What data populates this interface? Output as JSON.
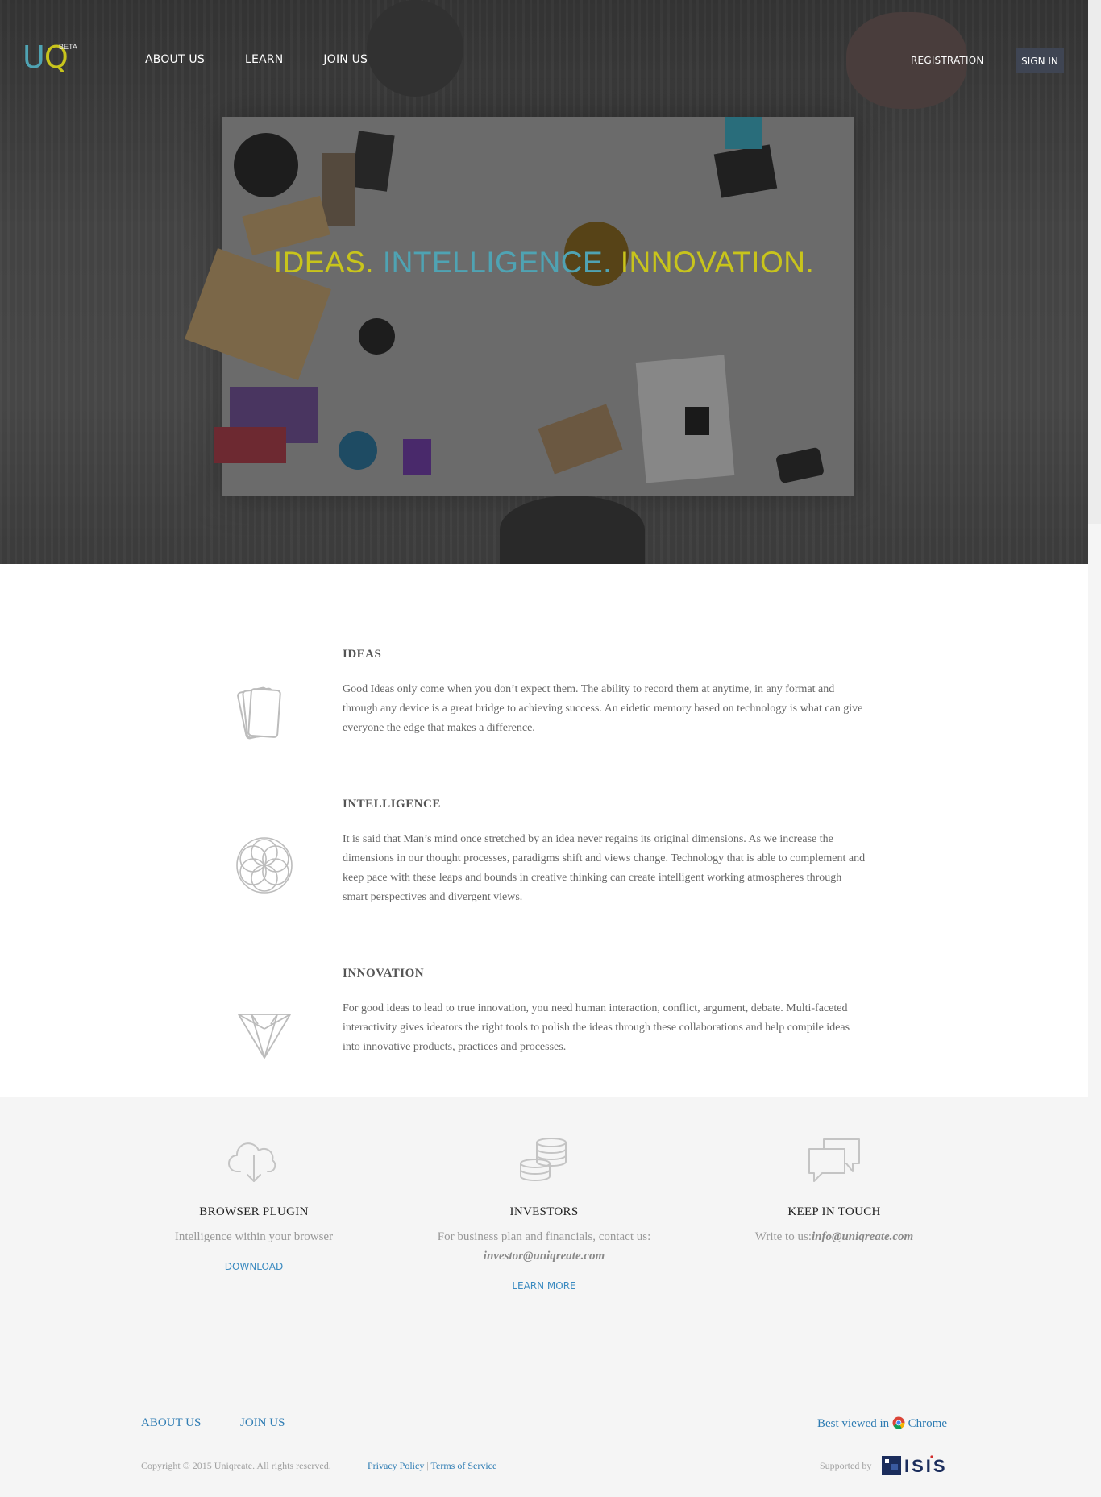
{
  "header": {
    "logo_u": "U",
    "logo_q": "Q",
    "beta": "BETA",
    "nav": [
      "ABOUT US",
      "LEARN",
      "JOIN US"
    ],
    "registration": "REGISTRATION",
    "sign_in": "SIGN IN"
  },
  "hero": {
    "tagline_1": "IDEAS.",
    "tagline_2": "INTELLIGENCE.",
    "tagline_3": "INNOVATION."
  },
  "features": [
    {
      "title": "IDEAS",
      "icon": "cards-icon",
      "text": "Good Ideas only come when you don’t expect them. The ability to record them at anytime, in any format and through any device is a great bridge to achieving success. An eidetic memory based on technology is what can give everyone the edge that makes a difference."
    },
    {
      "title": "INTELLIGENCE",
      "icon": "flower-of-life-icon",
      "text": "It is said that Man’s mind once stretched by an idea never regains its original dimensions. As we increase the dimensions in our thought processes, paradigms shift and views change. Technology that is able to complement and keep pace with these leaps and bounds in creative thinking can create intelligent working atmospheres through smart perspectives and divergent views."
    },
    {
      "title": "INNOVATION",
      "icon": "diamond-icon",
      "text": "For good ideas to lead to true innovation, you need human interaction, conflict, argument, debate. Multi-faceted interactivity gives ideators the right tools to polish the ideas through these collaborations and help compile ideas into innovative products, practices and processes."
    }
  ],
  "info": {
    "plugin": {
      "icon": "cloud-download-icon",
      "title": "BROWSER PLUGIN",
      "text": "Intelligence within your browser",
      "link": "DOWNLOAD"
    },
    "investors": {
      "icon": "coins-icon",
      "title": "INVESTORS",
      "text": "For business plan and financials, contact us:",
      "email": "investor@uniqreate.com",
      "link": "LEARN MORE"
    },
    "contact": {
      "icon": "chat-bubbles-icon",
      "title": "KEEP IN TOUCH",
      "text": "Write to us:",
      "email": "info@uniqreate.com"
    }
  },
  "footer": {
    "about": "ABOUT US",
    "join": "JOIN US",
    "best_viewed": "Best viewed in",
    "browser": "Chrome",
    "copyright": "Copyright © 2015 Uniqreate. All rights reserved.",
    "privacy": "Privacy Policy",
    "separator": "|",
    "terms": "Terms of Service",
    "supported_by": "Supported by",
    "sponsor": "ISIS"
  }
}
